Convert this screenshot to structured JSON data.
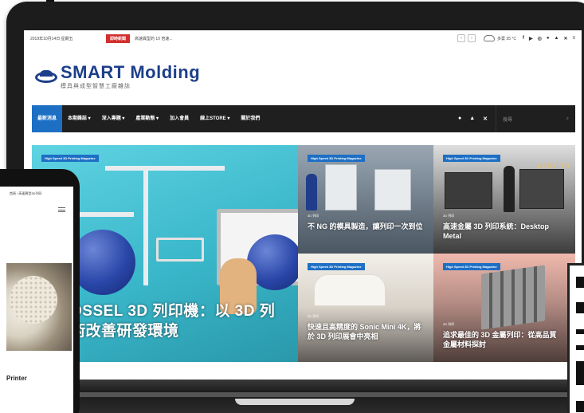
{
  "topbar": {
    "date": "2019年10月14日 星期五",
    "breaking_label": "即時新聞",
    "ticker": "高速異型的 10 倍速...",
    "weather": "多雲 35 °C",
    "social_icons": [
      "facebook-icon",
      "youtube-icon",
      "instagram-icon",
      "user-icon",
      "lock-icon",
      "shuffle-icon",
      "menu-icon"
    ]
  },
  "logo": {
    "title": "SMART Molding",
    "subtitle": "模具與成型智慧工廠雜誌"
  },
  "nav": {
    "items": [
      {
        "label": "最新消息",
        "active": true
      },
      {
        "label": "本期雜誌 ▾",
        "active": false
      },
      {
        "label": "深入專題 ▾",
        "active": false
      },
      {
        "label": "產業動態 ▾",
        "active": false
      },
      {
        "label": "加入會員",
        "active": false
      },
      {
        "label": "線上STORE ▾",
        "active": false
      },
      {
        "label": "關於我們",
        "active": false
      }
    ],
    "search_placeholder": "搜尋"
  },
  "grid": {
    "main": {
      "tag": "High Speed 3D Printing Magazine",
      "title_line1": "OSSEL 3D 列印機：以 3D 列",
      "title_line2": "術改善研發環境"
    },
    "tiles": [
      {
        "tag": "High Speed 3D Printing Magazine",
        "category": "3D 列印",
        "title": "不 NG 的模具製造，讓列印一次到位"
      },
      {
        "tag": "High Speed 3D Printing Magazine",
        "category": "3D 列印",
        "title": "高速金屬 3D 列印系統：Desktop Metal",
        "overlay_text": "EASY TO"
      },
      {
        "tag": "High Speed 3D Printing Magazine",
        "category": "3D 列印",
        "title": "快速且高精度的 Sonic Mini 4K，將於 3D 列印展會中亮相"
      },
      {
        "tag": "High Speed 3D Printing Magazine",
        "category": "3D 列印",
        "title": "追求最佳的 3D 金屬列印：從高品質金屬材料探討"
      }
    ]
  },
  "phone": {
    "breadcrumb": "首頁 / 高速異型3D列印",
    "title_fragment": "Printer"
  },
  "colors": {
    "brand_blue": "#1d3f8a",
    "nav_active": "#1d6fc4",
    "breaking_red": "#d32f2f",
    "nav_bg": "#1f1f1f",
    "hero_teal": "#3ab7ca"
  }
}
